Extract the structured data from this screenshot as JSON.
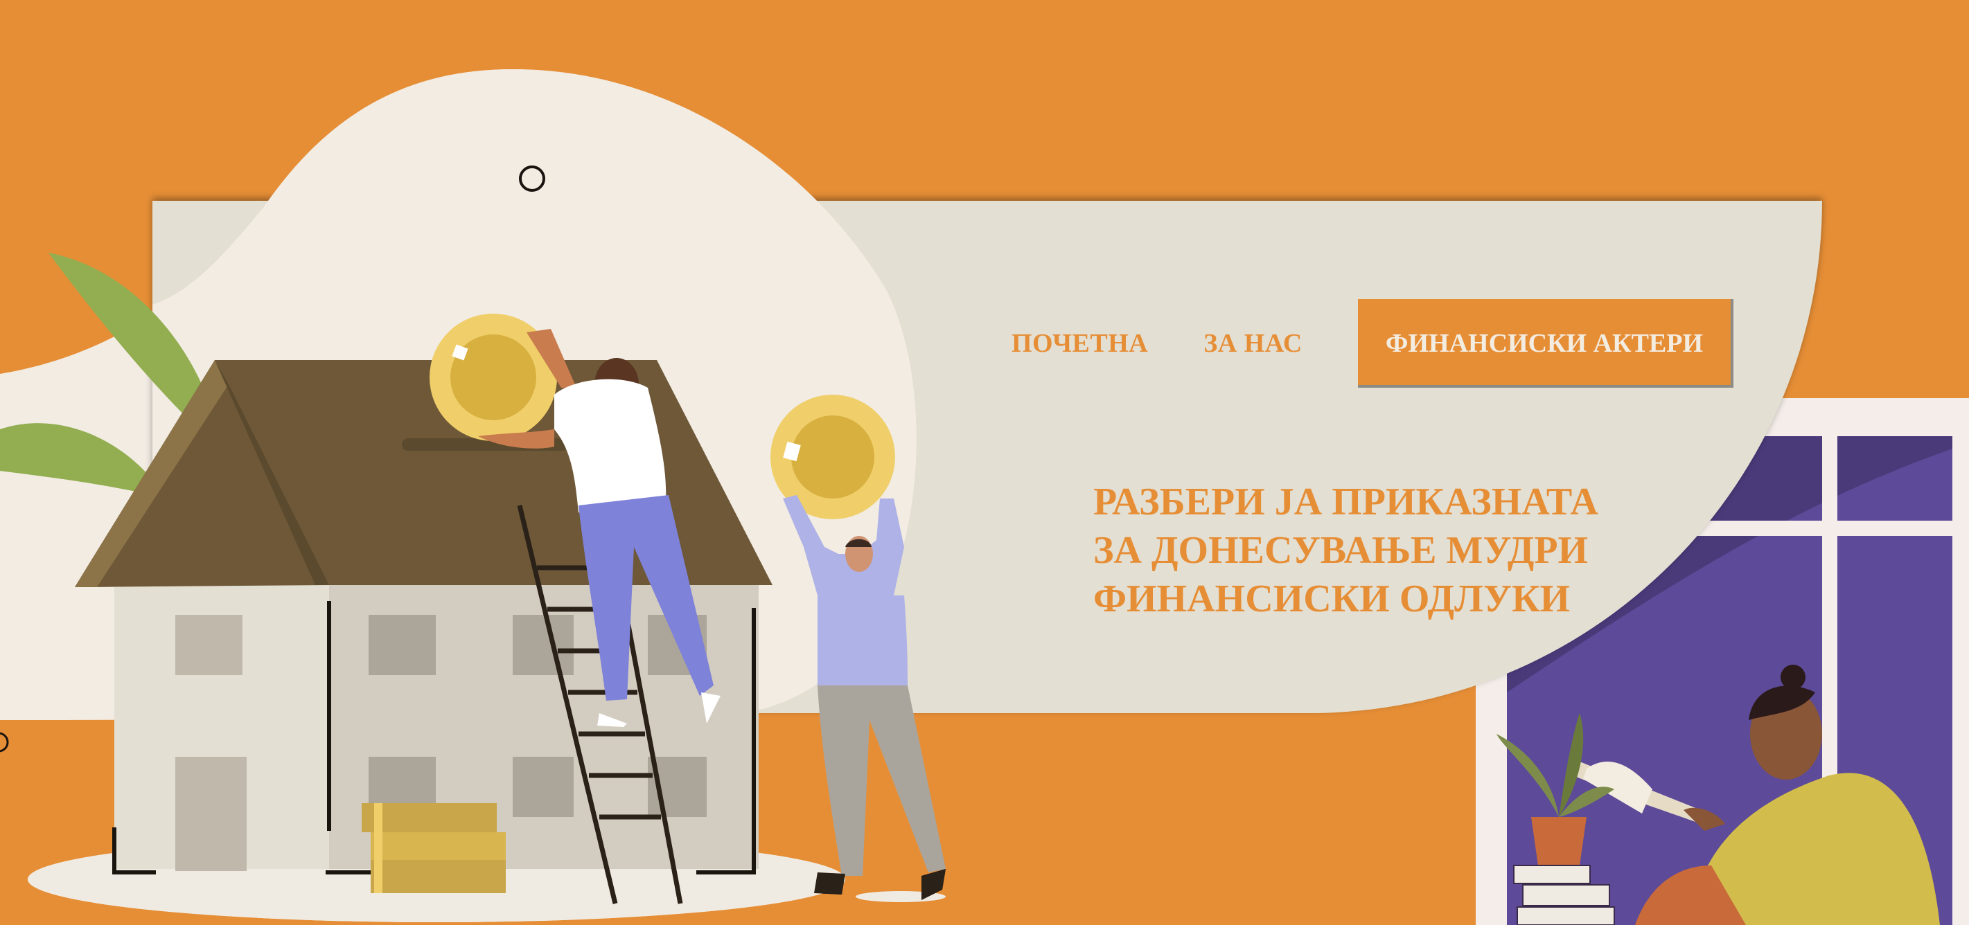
{
  "nav": {
    "items": [
      {
        "label": "ПОЧЕТНА"
      },
      {
        "label": "ЗА НАС"
      }
    ],
    "active_button": {
      "label": "ФИНАНСИСКИ АКТЕРИ"
    }
  },
  "hero": {
    "headline_lines": [
      "РАЗБЕРИ ЈА ПРИКАЗНАТА",
      "ЗА ДОНЕСУВАЊЕ МУДРИ",
      "ФИНАНСИСКИ ОДЛУКИ"
    ]
  },
  "icons": {
    "scroll_dot": "circle-outline-icon",
    "side_dot": "circle-outline-icon"
  },
  "colors": {
    "accent": "#e68e36",
    "panel": "#e4dfd3",
    "blob": "#f2ece3",
    "roof": "#6e5838",
    "coin": "#f0cf6a",
    "purple": "#5a4690"
  }
}
